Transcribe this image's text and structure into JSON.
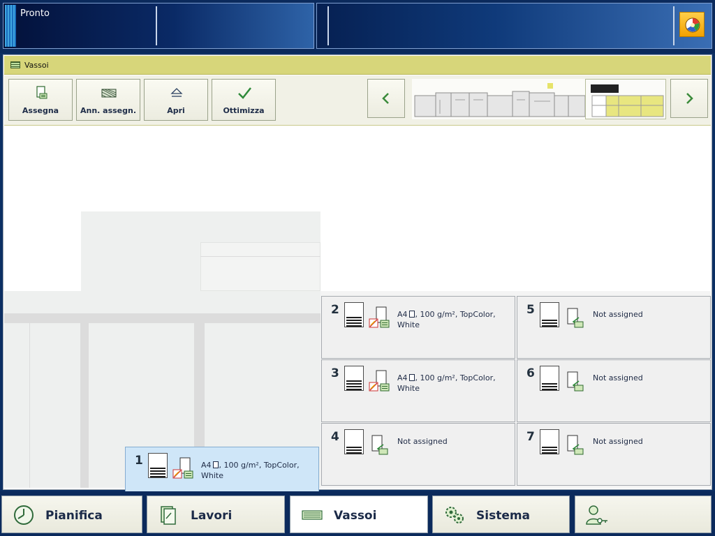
{
  "status": {
    "text": "Pronto"
  },
  "panel": {
    "title": "Vassoi"
  },
  "toolbar": {
    "buttons": [
      {
        "label": "Assegna",
        "icon": "assign-icon"
      },
      {
        "label": "Ann. assegn.",
        "icon": "unassign-icon"
      },
      {
        "label": "Apri",
        "icon": "eject-icon"
      },
      {
        "label": "Ottimizza",
        "icon": "checkmark-icon"
      }
    ]
  },
  "trays": [
    {
      "number": "1",
      "media_prefix": "A4",
      "media_suffix": ", 100 g/m², TopColor, White",
      "assigned": true,
      "selected": true
    },
    {
      "number": "2",
      "media_prefix": "A4",
      "media_suffix": ", 100 g/m², TopColor, White",
      "assigned": true,
      "selected": false
    },
    {
      "number": "3",
      "media_prefix": "A4",
      "media_suffix": ", 100 g/m², TopColor, White",
      "assigned": true,
      "selected": false
    },
    {
      "number": "4",
      "media_text": "Not assigned",
      "assigned": false,
      "selected": false
    },
    {
      "number": "5",
      "media_text": "Not assigned",
      "assigned": false,
      "selected": false
    },
    {
      "number": "6",
      "media_text": "Not assigned",
      "assigned": false,
      "selected": false
    },
    {
      "number": "7",
      "media_text": "Not assigned",
      "assigned": false,
      "selected": false
    }
  ],
  "bottom_nav": {
    "tabs": [
      {
        "label": "Pianifica",
        "icon": "clock-icon",
        "active": false
      },
      {
        "label": "Lavori",
        "icon": "jobs-icon",
        "active": false
      },
      {
        "label": "Vassoi",
        "icon": "trays-icon",
        "active": true
      },
      {
        "label": "Sistema",
        "icon": "gears-icon",
        "active": false
      },
      {
        "label": "",
        "icon": "user-key-icon",
        "active": false
      }
    ]
  },
  "colors": {
    "title_bar": "#d7d67a",
    "selected_tray": "#cfe6f8",
    "status_bar": "#0a2a66"
  }
}
